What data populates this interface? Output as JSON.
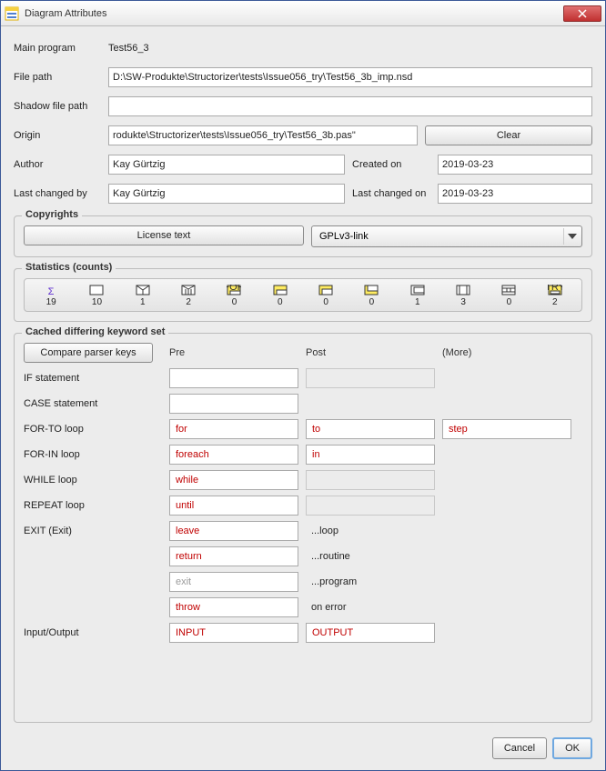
{
  "window": {
    "title": "Diagram Attributes"
  },
  "fields": {
    "main_program_label": "Main program",
    "main_program_value": "Test56_3",
    "file_path_label": "File path",
    "file_path_value": "D:\\SW-Produkte\\Structorizer\\tests\\Issue056_try\\Test56_3b_imp.nsd",
    "shadow_label": "Shadow file path",
    "shadow_value": "",
    "origin_label": "Origin",
    "origin_value": "rodukte\\Structorizer\\tests\\Issue056_try\\Test56_3b.pas\"",
    "clear_btn": "Clear",
    "author_label": "Author",
    "author_value": "Kay Gürtzig",
    "created_label": "Created on",
    "created_value": "2019-03-23",
    "changed_by_label": "Last changed by",
    "changed_by_value": "Kay Gürtzig",
    "changed_on_label": "Last changed on",
    "changed_on_value": "2019-03-23"
  },
  "copyrights": {
    "group_title": "Copyrights",
    "license_btn": "License text",
    "license_combo": "GPLv3-link"
  },
  "statistics": {
    "group_title": "Statistics (counts)",
    "items": [
      {
        "name": "sigma",
        "count": "19"
      },
      {
        "name": "box",
        "count": "10"
      },
      {
        "name": "alt",
        "count": "1"
      },
      {
        "name": "case",
        "count": "2"
      },
      {
        "name": "for",
        "count": "0"
      },
      {
        "name": "forin",
        "count": "0"
      },
      {
        "name": "while",
        "count": "0"
      },
      {
        "name": "repeat",
        "count": "0"
      },
      {
        "name": "endless",
        "count": "1"
      },
      {
        "name": "call",
        "count": "3"
      },
      {
        "name": "parallel",
        "count": "0"
      },
      {
        "name": "try",
        "count": "2"
      }
    ]
  },
  "keywords": {
    "group_title": "Cached differing keyword set",
    "compare_btn": "Compare parser keys",
    "col_pre": "Pre",
    "col_post": "Post",
    "col_more": "(More)",
    "rows": {
      "if_label": "IF statement",
      "if_pre": "",
      "case_label": "CASE statement",
      "case_pre": "",
      "forto_label": "FOR-TO loop",
      "forto_pre": "for",
      "forto_post": "to",
      "forto_more": "step",
      "forin_label": "FOR-IN loop",
      "forin_pre": "foreach",
      "forin_post": "in",
      "while_label": "WHILE loop",
      "while_pre": "while",
      "repeat_label": "REPEAT loop",
      "repeat_pre": "until",
      "exit_label": "EXIT (Exit)",
      "exit_pre_leave": "leave",
      "exit_post_loop": "...loop",
      "exit_pre_return": "return",
      "exit_post_routine": "...routine",
      "exit_pre_exit": "exit",
      "exit_post_program": "...program",
      "exit_pre_throw": "throw",
      "exit_post_error": "on error",
      "io_label": "Input/Output",
      "io_pre": "INPUT",
      "io_post": "OUTPUT"
    }
  },
  "footer": {
    "cancel": "Cancel",
    "ok": "OK"
  }
}
